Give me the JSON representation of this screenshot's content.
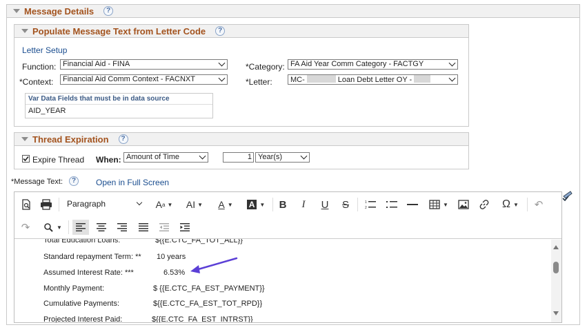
{
  "message_details": {
    "title": "Message Details",
    "help": "?"
  },
  "populate": {
    "title": "Populate Message Text from Letter Code",
    "help": "?",
    "letter_setup_link": "Letter Setup",
    "function_label": "Function:",
    "function_value": "Financial Aid - FINA",
    "category_label": "*Category:",
    "category_value": "FA Aid Year Comm Category - FACTGY",
    "context_label": "*Context:",
    "context_value": "Financial Aid Comm Context - FACNXT",
    "letter_label": "*Letter:",
    "letter_prefix": "MC-",
    "letter_middle": "Loan Debt Letter OY -",
    "var_title": "Var Data Fields that must be in data source",
    "var_value": "AID_YEAR"
  },
  "thread": {
    "title": "Thread Expiration",
    "help": "?",
    "expire_label": "Expire Thread",
    "expire_checked": true,
    "when_label": "When:",
    "when_value": "Amount of Time",
    "amount_value": "1",
    "unit_value": "Year(s)"
  },
  "message_text": {
    "label": "*Message Text:",
    "help": "?",
    "fullscreen_link": "Open in Full Screen"
  },
  "editor": {
    "format_value": "Paragraph",
    "rows": [
      {
        "label": "Total Education Loans:",
        "value": "${{E.CTC_FA_TOT_ALL}}"
      },
      {
        "label": "Standard repayment Term: **",
        "value": "10 years"
      },
      {
        "label": "Assumed Interest Rate: ***",
        "value": "6.53%"
      },
      {
        "label": "Monthly Payment:",
        "value": "$ {{E.CTC_FA_EST_PAYMENT}}"
      },
      {
        "label": "Cumulative Payments:",
        "value": "${{E.CTC_FA_EST_TOT_RPD}}"
      },
      {
        "label": "Projected Interest Paid:",
        "value": "${{E.CTC_FA_EST_INTRST}}"
      }
    ]
  },
  "colors": {
    "header_text": "#a3531e",
    "link": "#1a4d8f",
    "arrow": "#5b3fd6"
  }
}
